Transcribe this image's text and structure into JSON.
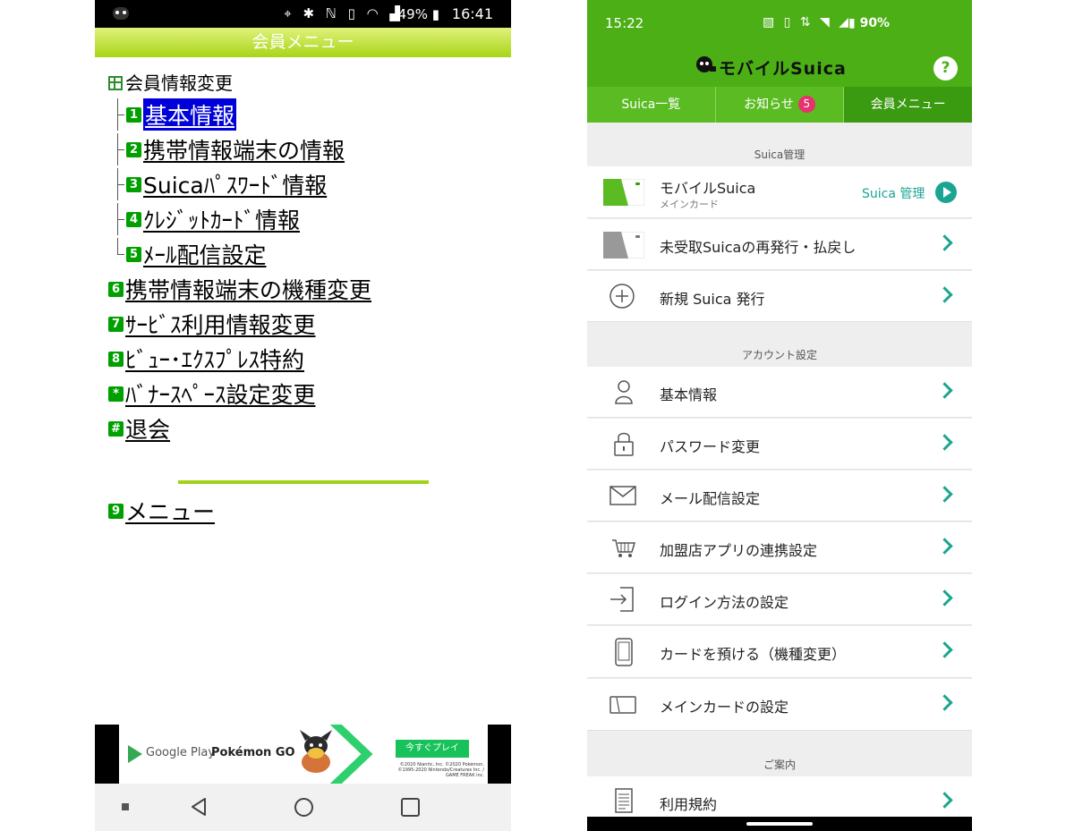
{
  "left": {
    "status_bar": {
      "icons": "⌖ ✱ ℕ ▯ ◠ ▟",
      "battery": "49% ▮",
      "time": "16:41"
    },
    "title": "会員メニュー",
    "menu_header": "会員情報変更",
    "menu_items": [
      {
        "num": "1",
        "label": "基本情報"
      },
      {
        "num": "2",
        "label": "携帯情報端末の情報"
      },
      {
        "num": "3",
        "label": "Suicaﾊﾟｽﾜｰﾄﾞ情報"
      },
      {
        "num": "4",
        "label": "ｸﾚｼﾞｯﾄｶｰﾄﾞ情報"
      },
      {
        "num": "5",
        "label": "ﾒｰﾙ配信設定"
      },
      {
        "num": "6",
        "label": "携帯情報端末の機種変更"
      },
      {
        "num": "7",
        "label": "ｻｰﾋﾞｽ利用情報変更"
      },
      {
        "num": "8",
        "label": "ﾋﾞｭｰ･ｴｸｽﾌﾟﾚｽ特約"
      },
      {
        "num": "*",
        "label": "ﾊﾞﾅｰｽﾍﾟｰｽ設定変更"
      },
      {
        "num": "#",
        "label": "退会"
      },
      {
        "num": "9",
        "label": "メニュー"
      }
    ],
    "ad": {
      "store": "Google Play",
      "app": "Pokémon GO",
      "cta": "今すぐプレイ",
      "copyright": "©2020 Niantic, Inc. ©2020 Pokémon. ©1995-2020 Nintendo/Creatures Inc. / GAME FREAK inc."
    }
  },
  "right": {
    "status_bar": {
      "time": "15:22",
      "icons": "▧ ▯ ⇅ ◥ ◢",
      "battery": "▮ 90%"
    },
    "app_title": "モバイルSuica",
    "help": "?",
    "tabs": [
      {
        "label": "Suica一覧"
      },
      {
        "label": "お知らせ",
        "badge": "5"
      },
      {
        "label": "会員メニュー",
        "active": true
      }
    ],
    "sections": [
      {
        "heading": "Suica管理"
      },
      {
        "heading": "アカウント設定"
      },
      {
        "heading": "ご案内"
      }
    ],
    "suica_rows": [
      {
        "label": "モバイルSuica",
        "sub": "メインカード",
        "action": "Suica 管理",
        "icon": "green-card-icon"
      },
      {
        "label": "未受取Suicaの再発行・払戻し",
        "icon": "gray-card-icon"
      },
      {
        "label": "新規 Suica 発行",
        "icon": "plus-circle-icon"
      }
    ],
    "account_rows": [
      {
        "label": "基本情報",
        "icon": "person-icon"
      },
      {
        "label": "パスワード変更",
        "icon": "lock-icon"
      },
      {
        "label": "メール配信設定",
        "icon": "mail-icon"
      },
      {
        "label": "加盟店アプリの連携設定",
        "icon": "cart-icon"
      },
      {
        "label": "ログイン方法の設定",
        "icon": "login-icon"
      },
      {
        "label": "カードを預ける（機種変更）",
        "icon": "phone-icon"
      },
      {
        "label": "メインカードの設定",
        "icon": "card-outline-icon"
      }
    ],
    "info_rows": [
      {
        "label": "利用規約",
        "icon": "document-icon"
      }
    ],
    "colors": {
      "green": "#4caf16",
      "tab_active": "#3a9a10",
      "teal": "#1aa592",
      "badge_pink": "#e8316f"
    }
  }
}
